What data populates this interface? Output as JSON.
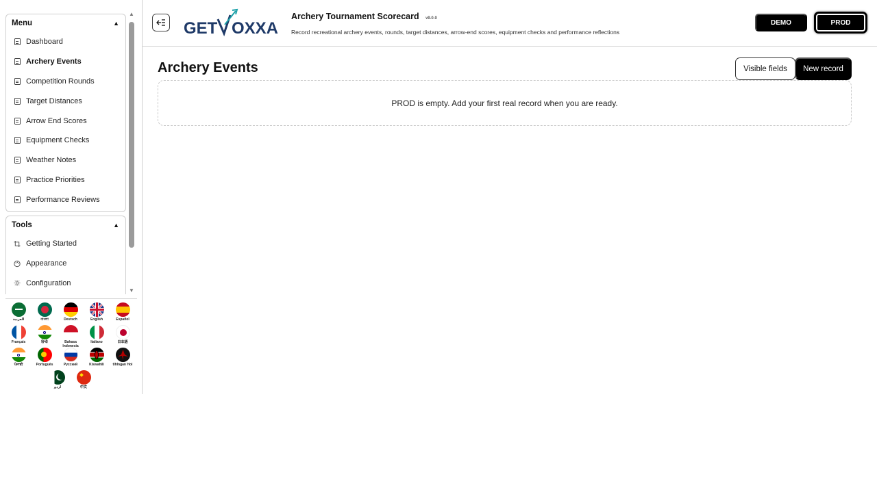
{
  "sidebar": {
    "menu": {
      "title": "Menu",
      "items": [
        {
          "label": "Dashboard"
        },
        {
          "label": "Archery Events"
        },
        {
          "label": "Competition Rounds"
        },
        {
          "label": "Target Distances"
        },
        {
          "label": "Arrow End Scores"
        },
        {
          "label": "Equipment Checks"
        },
        {
          "label": "Weather Notes"
        },
        {
          "label": "Practice Priorities"
        },
        {
          "label": "Performance Reviews"
        }
      ]
    },
    "tools": {
      "title": "Tools",
      "items": [
        {
          "label": "Getting Started"
        },
        {
          "label": "Appearance"
        },
        {
          "label": "Configuration"
        }
      ]
    },
    "languages": [
      {
        "label": "العربية"
      },
      {
        "label": "বাংলা"
      },
      {
        "label": "Deutsch"
      },
      {
        "label": "English"
      },
      {
        "label": "Español"
      },
      {
        "label": "Français"
      },
      {
        "label": "हिन्दी"
      },
      {
        "label": "Bahasa Indonesia"
      },
      {
        "label": "Italiano"
      },
      {
        "label": "日本語"
      },
      {
        "label": "ਪੰਜਾਬੀ"
      },
      {
        "label": "Português"
      },
      {
        "label": "Русский"
      },
      {
        "label": "Kiswahili"
      },
      {
        "label": "tlhIngan Hol"
      },
      {
        "label": "اردو"
      },
      {
        "label": "中文"
      }
    ]
  },
  "header": {
    "logo_text_left": "GET",
    "logo_text_right": "OXXA",
    "title": "Archery Tournament Scorecard",
    "version": "v9.0.0",
    "subtitle": "Record recreational archery events, rounds, target distances, arrow-end scores, equipment checks and performance reflections",
    "env_demo": "DEMO",
    "env_prod": "PROD"
  },
  "main": {
    "page_title": "Archery Events",
    "visible_fields_label": "Visible fields",
    "new_record_label": "New record",
    "empty_message": "PROD is empty. Add your first real record when you are ready."
  },
  "colors": {
    "primary": "#000000",
    "logo_navy": "#1f3a68",
    "logo_teal": "#1aa0a8"
  }
}
